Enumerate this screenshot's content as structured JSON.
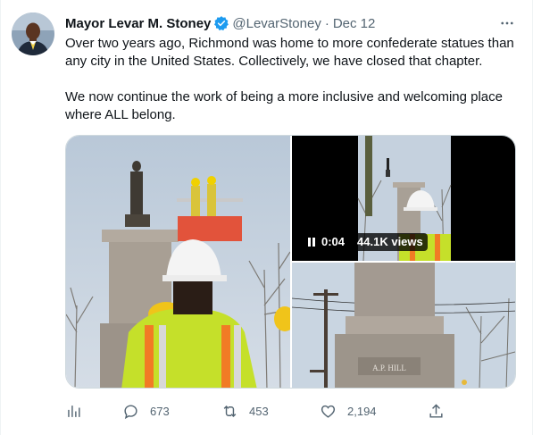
{
  "tweet": {
    "author_name": "Mayor Levar M. Stoney",
    "handle": "@LevarStoney",
    "separator": "·",
    "date": "Dec 12",
    "text_paragraph_1": "Over two years ago, Richmond was home to more confederate statues than any city in the United States. Collectively, we have closed that chapter.",
    "text_paragraph_2": "We now continue the work of being a more inclusive and welcoming place where ALL belong."
  },
  "media": {
    "video_time": "0:04",
    "video_views": "44.1K views",
    "monument_inscription": "A.P. HILL"
  },
  "actions": {
    "replies": "673",
    "retweets": "453",
    "likes": "2,194"
  },
  "colors": {
    "verified": "#1d9bf0",
    "secondary_text": "#536471",
    "border": "#cfd9de"
  },
  "icons": [
    "verified-badge-icon",
    "more-icon",
    "pause-icon",
    "analytics-icon",
    "reply-icon",
    "retweet-icon",
    "like-icon",
    "share-icon"
  ]
}
